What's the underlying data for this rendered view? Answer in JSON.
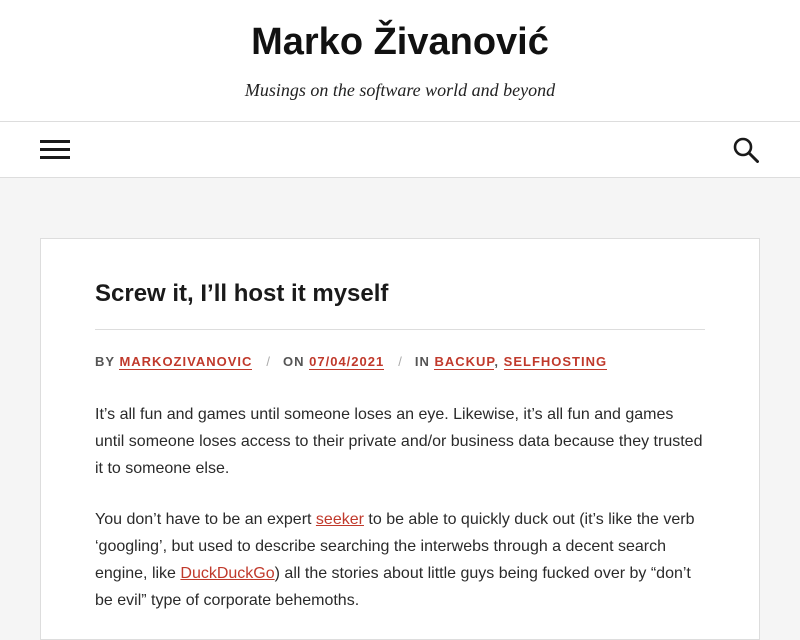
{
  "site": {
    "title": "Marko Živanović",
    "tagline": "Musings on the software world and beyond"
  },
  "nav": {
    "menu_icon": "hamburger-menu-icon",
    "search_icon": "search-icon"
  },
  "post": {
    "title": "Screw it, I’ll host it myself",
    "meta": {
      "by_label": "BY",
      "author": "MARKOZIVANOVIC",
      "on_label": "ON",
      "date": "07/04/2021",
      "in_label": "IN",
      "categories": [
        "BACKUP",
        "SELFHOSTING"
      ],
      "separator": "/",
      "category_separator": ","
    },
    "paragraph1": "It’s all fun and games until someone loses an eye. Likewise, it’s all fun and games until someone loses access to their private and/or business data because they trusted it to someone else.",
    "paragraph2": {
      "part1": "You don’t have to be an expert ",
      "link1": "seeker",
      "part2": " to be able to quickly duck out (it’s like the verb ‘googling’, but used to describe searching the interwebs through a decent search engine, like ",
      "link2": "DuckDuckGo",
      "part3": ") all the stories about little guys being fucked over by “don’t be evil” type of corporate behemoths."
    }
  },
  "colors": {
    "accent": "#c0392b",
    "text": "#1a1a1a",
    "background": "#f5f5f5",
    "border": "#dddddd"
  }
}
